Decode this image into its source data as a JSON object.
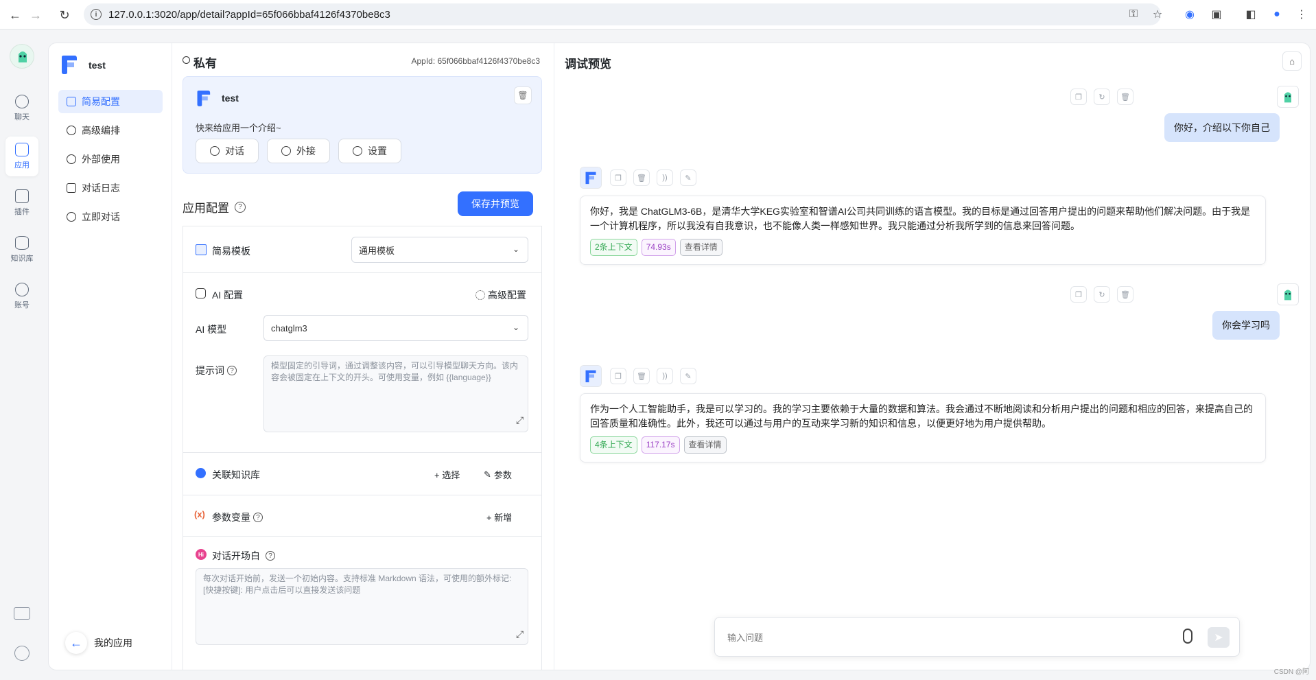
{
  "browser": {
    "url": "127.0.0.1:3020/app/detail?appId=65f066bbaf4126f4370be8c3"
  },
  "leftnav": {
    "items": [
      {
        "label": "聊天"
      },
      {
        "label": "应用"
      },
      {
        "label": "插件"
      },
      {
        "label": "知识库"
      },
      {
        "label": "账号"
      }
    ]
  },
  "subside": {
    "app_name": "test",
    "menu": [
      {
        "label": "简易配置"
      },
      {
        "label": "高级编排"
      },
      {
        "label": "外部使用"
      },
      {
        "label": "对话日志"
      },
      {
        "label": "立即对话"
      }
    ],
    "back_label": "我的应用"
  },
  "config": {
    "visibility": "私有",
    "app_id": "AppId: 65f066bbaf4126f4370be8c3",
    "card": {
      "name": "test",
      "intro": "快来给应用一个介绍~",
      "buttons": [
        "对话",
        "外接",
        "设置"
      ]
    },
    "section_title": "应用配置",
    "save_label": "保存并预览",
    "template_label": "简易模板",
    "template_value": "通用模板",
    "ai_config_label": "AI 配置",
    "advanced_label": "高级配置",
    "model_label": "AI 模型",
    "model_value": "chatglm3",
    "prompt_label": "提示词",
    "prompt_placeholder": "模型固定的引导词，通过调整该内容，可以引导模型聊天方向。该内容会被固定在上下文的开头。可使用变量，例如 {{language}}",
    "kb_label": "关联知识库",
    "kb_select": "+ 选择",
    "kb_params": "参数",
    "vars_label": "参数变量",
    "vars_add": "+ 新增",
    "opening_label": "对话开场白",
    "opening_placeholder": "每次对话开始前，发送一个初始内容。支持标准 Markdown 语法，可使用的额外标记: [快捷按键]: 用户点击后可以直接发送该问题"
  },
  "chat": {
    "title": "调试预览",
    "messages": [
      {
        "role": "user",
        "text": "你好，介绍以下你自己"
      },
      {
        "role": "ai",
        "text": "你好，我是 ChatGLM3-6B，是清华大学KEG实验室和智谱AI公司共同训练的语言模型。我的目标是通过回答用户提出的问题来帮助他们解决问题。由于我是一个计算机程序，所以我没有自我意识，也不能像人类一样感知世界。我只能通过分析我所学到的信息来回答问题。",
        "context": "2条上下文",
        "time": "74.93s",
        "detail": "查看详情"
      },
      {
        "role": "user",
        "text": "你会学习吗"
      },
      {
        "role": "ai",
        "text": "作为一个人工智能助手，我是可以学习的。我的学习主要依赖于大量的数据和算法。我会通过不断地阅读和分析用户提出的问题和相应的回答，来提高自己的回答质量和准确性。此外，我还可以通过与用户的互动来学习新的知识和信息，以便更好地为用户提供帮助。",
        "context": "4条上下文",
        "time": "117.17s",
        "detail": "查看详情"
      }
    ],
    "input_placeholder": "输入问题"
  },
  "watermark": "CSDN @阿",
  "colors": {
    "accent": "#3370ff",
    "user_bubble": "#d6e4fc"
  }
}
